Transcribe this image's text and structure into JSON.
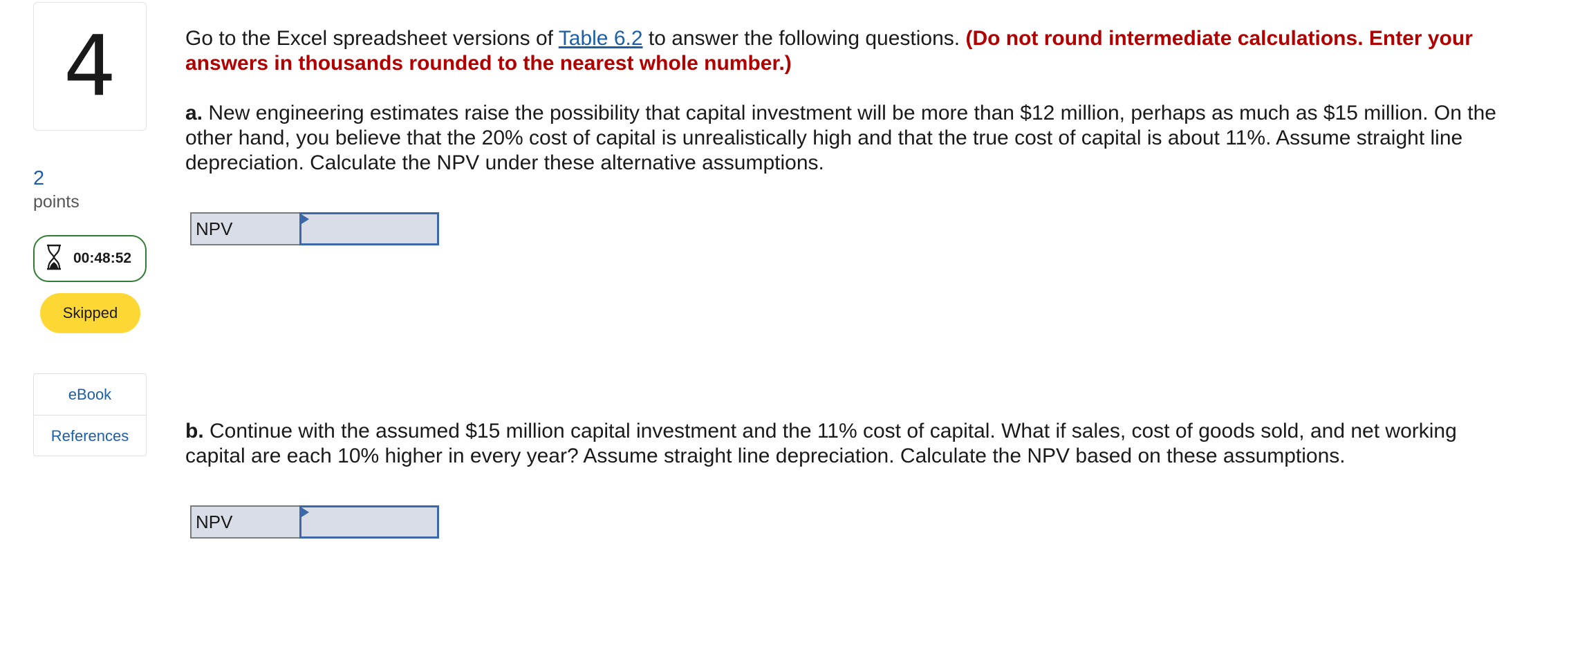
{
  "question_number": "4",
  "points": {
    "value": "2",
    "label": "points"
  },
  "timer": {
    "time": "00:48:52",
    "icon": "hourglass-icon"
  },
  "status_badge": "Skipped",
  "resources": {
    "ebook": "eBook",
    "references": "References"
  },
  "instructions": {
    "prefix": "Go to the Excel spreadsheet versions of ",
    "link": "Table 6.2",
    "middle": " to answer the following questions. ",
    "bold_red": "(Do not round intermediate calculations. Enter your answers in thousands rounded to the nearest whole number.)"
  },
  "part_a": {
    "letter": "a.",
    "text": " New engineering estimates raise the possibility that capital investment will be more than $12 million, perhaps as much as $15 million. On the other hand, you believe that the 20% cost of capital is unrealistically high and that the true cost of capital is about 11%. Assume straight line depreciation. Calculate the NPV under these alternative assumptions.",
    "answer_label": "NPV",
    "answer_value": ""
  },
  "part_b": {
    "letter": "b.",
    "text": " Continue with the assumed $15 million capital investment and the 11% cost of capital. What if sales, cost of goods sold, and net working capital are each 10% higher in every year? Assume straight line depreciation. Calculate the NPV based on these assumptions.",
    "answer_label": "NPV",
    "answer_value": ""
  },
  "colors": {
    "link": "#1d5ea8",
    "warning_red": "#b00000",
    "timer_border": "#2e7d32",
    "badge": "#fdd835",
    "input_border": "#3d68a8"
  }
}
